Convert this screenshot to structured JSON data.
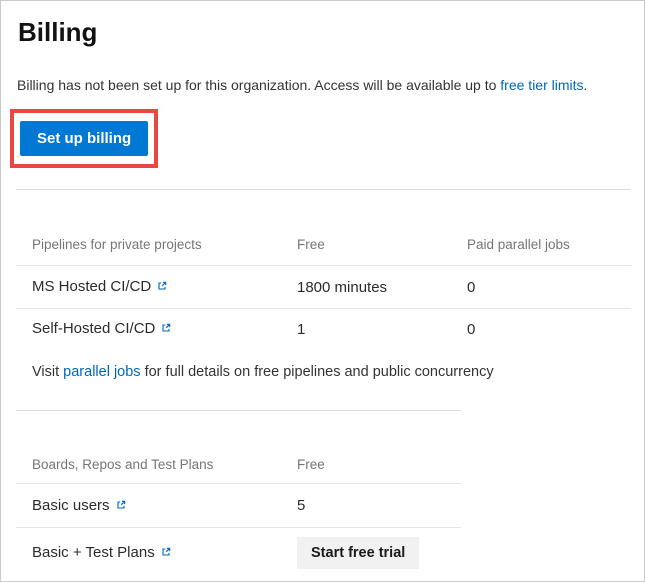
{
  "page": {
    "title": "Billing",
    "intro": {
      "before_link": "Billing has not been set up for this organization. Access will be available up to ",
      "link": "free tier limits",
      "after_link": "."
    },
    "setup_button": "Set up billing"
  },
  "pipelines_section": {
    "headers": {
      "name": "Pipelines for private projects",
      "free": "Free",
      "paid": "Paid parallel jobs"
    },
    "rows": [
      {
        "label": "MS Hosted CI/CD",
        "free": "1800 minutes",
        "paid": "0"
      },
      {
        "label": "Self-Hosted CI/CD",
        "free": "1",
        "paid": "0"
      }
    ],
    "note": {
      "before_link": "Visit ",
      "link": "parallel jobs",
      "after_link": " for full details on free pipelines and public concurrency"
    }
  },
  "boards_section": {
    "headers": {
      "name": "Boards, Repos and Test Plans",
      "free": "Free"
    },
    "rows": [
      {
        "label": "Basic users",
        "free": "5"
      },
      {
        "label": "Basic + Test Plans"
      }
    ],
    "trial_button": "Start free trial"
  },
  "icons": {
    "external_link": "open-in-new-window"
  },
  "colors": {
    "accent_blue": "#0078d4",
    "link_blue": "#0067b8",
    "annotation_red": "#e84742",
    "header_gray": "#767676",
    "text_dark": "#2b2b2b",
    "divider_gray": "#dcdcdc",
    "trial_button_bg": "#f1f1f1"
  }
}
